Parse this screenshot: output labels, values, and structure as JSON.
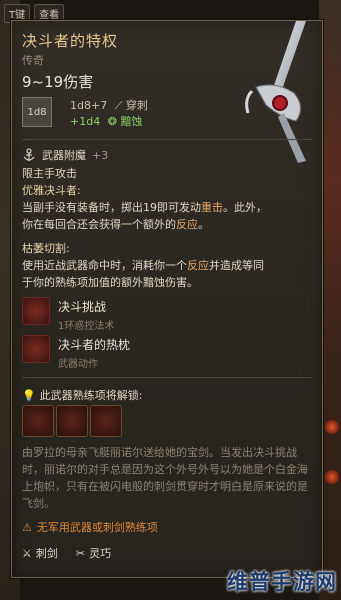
{
  "tabs": {
    "t_key": "T键",
    "view_label": "查看"
  },
  "item": {
    "name": "决斗者的特权",
    "rarity": "传奇",
    "damage": "9~19伤害",
    "dice_icon_text": "1d8",
    "damage_base": "1d8+7",
    "damage_base_type": "穿刺",
    "damage_bonus": "+1d4",
    "damage_bonus_type": "黯蚀"
  },
  "enchant": {
    "label": "武器附魔",
    "value": "+3"
  },
  "texts": {
    "offhand_restriction": "限主手攻击",
    "elegant_head": "优雅决斗者:",
    "elegant_body_1": "当副手没有装备时，掷出19即可发动",
    "elegant_hl": "重击",
    "elegant_body_2": "。此外，",
    "elegant_body_3": "你在每回合还会获得一个额外的",
    "elegant_hl2": "反应",
    "elegant_body_4": "。",
    "withered_head": "枯萎切割:",
    "withered_body_1": "使用近战武器命中时，消耗你一个",
    "withered_hl": "反应",
    "withered_body_2": "并造成等同",
    "withered_body_3": "于你的熟练项加值的额外黯蚀伤害。"
  },
  "abilities": [
    {
      "name": "决斗挑战",
      "sub": "1环惑控法术"
    },
    {
      "name": "决斗者的热枕",
      "sub": "武器动作"
    }
  ],
  "unlock": {
    "label": "此武器熟练项将解锁:"
  },
  "lore": "由罗拉的母亲飞艇丽诺尔送给她的宝剑。当发出决斗挑战时，丽诺尔的对手总是因为这个外号外号以为她是个白金海上炮帜，只有在被闪电般的刺剑贯穿时才明白是原来说的是飞剑。",
  "warning": "无军用武器或刺剑熟练项",
  "tags": [
    {
      "label": "刺剑"
    },
    {
      "label": "灵巧"
    }
  ],
  "watermark": "维普手游网",
  "colors": {
    "title": "#e8c892",
    "bonus_green": "#8fd36a",
    "highlight": "#e8a86a",
    "warning": "#e08a3a"
  }
}
